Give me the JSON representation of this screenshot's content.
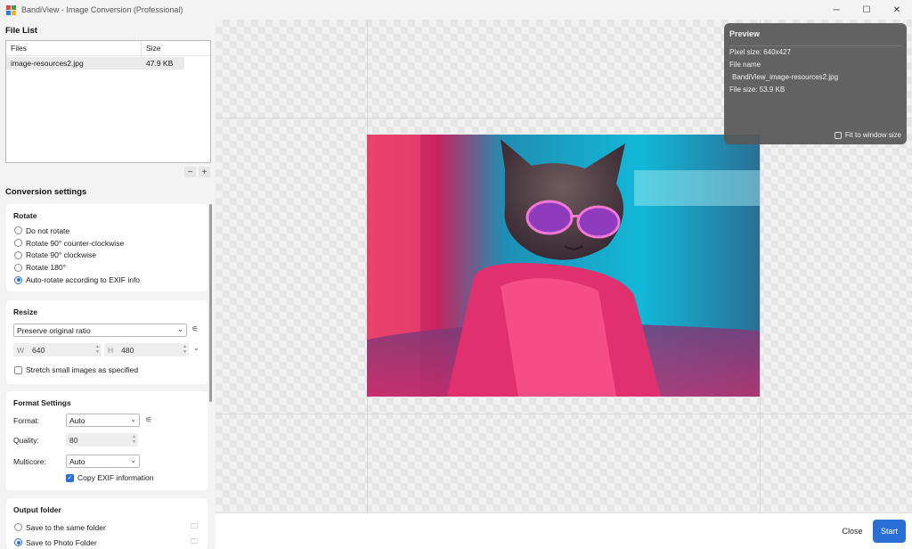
{
  "titlebar": {
    "title": "BandiView - Image Conversion (Professional)",
    "minimize": "─",
    "maximize": "☐",
    "close": "✕"
  },
  "file_list": {
    "title": "File List",
    "columns": [
      "Files",
      "Size"
    ],
    "rows": [
      {
        "name": "image-resources2.jpg",
        "size": "47.9 KB"
      }
    ],
    "remove": "−",
    "add": "+"
  },
  "conversion": {
    "title": "Conversion settings",
    "rotate": {
      "title": "Rotate",
      "options": [
        "Do not rotate",
        "Rotate 90° counter-clockwise",
        "Rotate 90° clockwise",
        "Rotate 180°",
        "Auto-rotate according to EXIF info"
      ],
      "selected_index": 4
    },
    "resize": {
      "title": "Resize",
      "mode": "Preserve original ratio",
      "w_label": "W",
      "w_value": "640",
      "h_label": "H",
      "h_value": "480",
      "stretch_label": "Stretch small images as specified",
      "stretch_checked": false
    },
    "format": {
      "title": "Format Settings",
      "format_label": "Format:",
      "format_value": "Auto",
      "quality_label": "Quality:",
      "quality_value": "80",
      "multicore_label": "Multicore:",
      "multicore_value": "Auto",
      "exif_label": "Copy EXIF information",
      "exif_checked": true
    },
    "output": {
      "title": "Output folder",
      "options": [
        "Save to the same folder",
        "Save to Photo Folder"
      ],
      "selected_index": 1
    }
  },
  "preview": {
    "title": "Preview",
    "pixel_size": "Pixel size: 640x427",
    "file_name_label": "File name",
    "file_name": "BandiView_image-resources2.jpg",
    "file_size": "File size: 53.9 KB",
    "fit_label": "Fit to window size",
    "fit_checked": false
  },
  "actions": {
    "close": "Close",
    "start": "Start"
  },
  "colors": {
    "accent": "#2a6fd6"
  }
}
